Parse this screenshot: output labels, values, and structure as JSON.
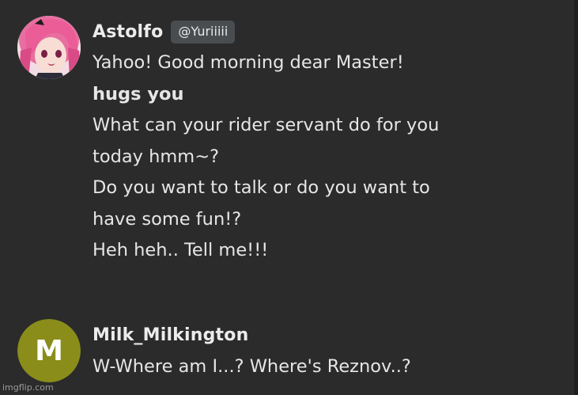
{
  "messages": [
    {
      "author": "Astolfo",
      "tag": "@Yuriiiii",
      "avatar_type": "anime-character-portrait",
      "lines": [
        "Yahoo! Good morning dear Master!",
        "hugs you",
        "What can your rider servant do for you",
        "today hmm~?",
        "Do you want to talk or do you want to",
        "have some fun!?",
        "Heh heh.. Tell me!!!"
      ]
    },
    {
      "author": "Milk_Milkington",
      "avatar_letter": "M",
      "avatar_color": "#8a8d1a",
      "lines": [
        "W-Where am I...? Where's Reznov..?"
      ]
    }
  ],
  "watermark": "imgflip.com",
  "colors": {
    "background": "#2b2b2b",
    "tag_bg": "#4a4d50",
    "text": "#e6e6e6"
  }
}
